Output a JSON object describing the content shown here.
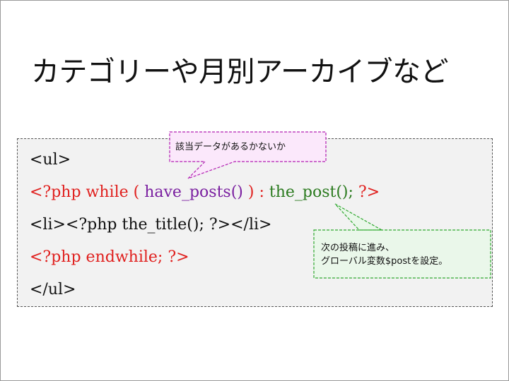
{
  "slide": {
    "title": "カテゴリーや月別アーカイブなど"
  },
  "code": {
    "line1": "<ul>",
    "line2_open": "<?php while ( ",
    "line2_func": "have_posts()",
    "line2_close": " ) : ",
    "line2_post": "the_post();",
    "line2_end": " ?>",
    "line3": "<li><?php the_title(); ?></li>",
    "line4": "<?php endwhile; ?>",
    "line5": "</ul>"
  },
  "callouts": {
    "have_posts": "該当データがあるかないか",
    "the_post_line1": "次の投稿に進み、",
    "the_post_line2": "グローバル変数$postを設定。"
  },
  "colors": {
    "php_tag": "#e0201e",
    "have_posts": "#7a1fa0",
    "the_post": "#2a7a1e",
    "callout_purple_fill": "#fbe8fb",
    "callout_purple_border": "#b21fb2",
    "callout_green_fill": "#eaf7ea",
    "callout_green_border": "#2fa82f"
  }
}
